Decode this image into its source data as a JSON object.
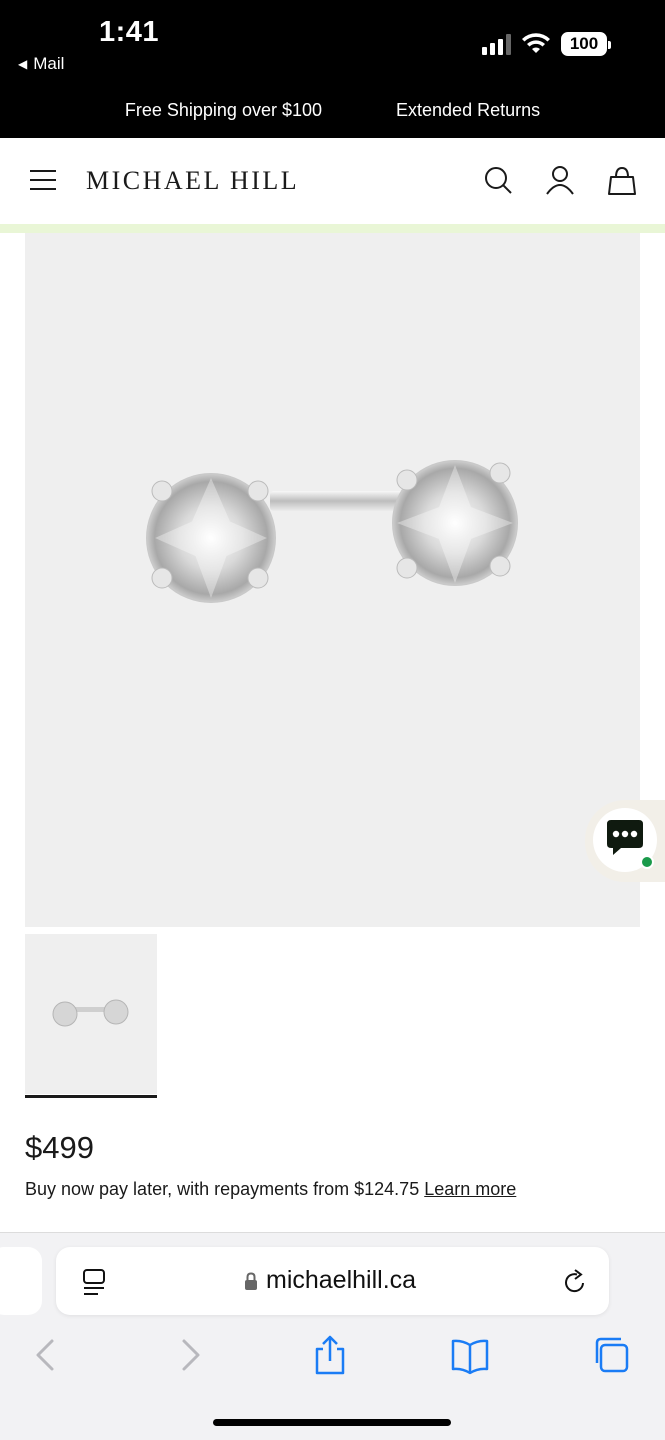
{
  "status_bar": {
    "time": "1:41",
    "back_label": "Mail",
    "battery": "100"
  },
  "promo": {
    "items": [
      "Free Shipping over $100",
      "Extended Returns"
    ]
  },
  "header": {
    "brand": "MICHAEL HILL"
  },
  "product": {
    "price": "$499",
    "bnpl_text": "Buy now pay later, with repayments from $124.75",
    "learn_more": "Learn more"
  },
  "browser": {
    "url": "michaelhill.ca"
  },
  "colors": {
    "accent_strip": "#e9f6d6",
    "chat_online": "#1a9a4a",
    "safari_blue": "#1a7cf5"
  }
}
